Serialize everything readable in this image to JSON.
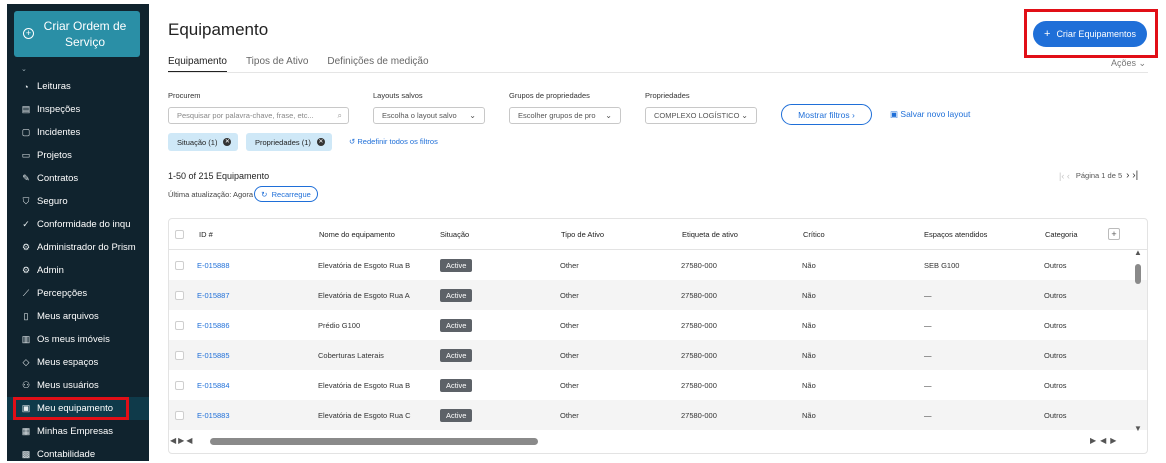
{
  "sidebar": {
    "create_label": "Criar Ordem de Serviço",
    "items": [
      {
        "label": "Leituras",
        "icon": "gauge-icon"
      },
      {
        "label": "Inspeções",
        "icon": "clipboard-icon"
      },
      {
        "label": "Incidentes",
        "icon": "alert-icon"
      },
      {
        "label": "Projetos",
        "icon": "folder-icon"
      },
      {
        "label": "Contratos",
        "icon": "contract-icon"
      },
      {
        "label": "Seguro",
        "icon": "shield-icon"
      },
      {
        "label": "Conformidade do inqu",
        "icon": "check-circle-icon"
      },
      {
        "label": "Administrador do Prism",
        "icon": "settings-icon"
      },
      {
        "label": "Admin",
        "icon": "settings-icon"
      },
      {
        "label": "Percepções",
        "icon": "trend-icon"
      },
      {
        "label": "Meus arquivos",
        "icon": "file-icon"
      },
      {
        "label": "Os meus imóveis",
        "icon": "building-icon"
      },
      {
        "label": "Meus espaços",
        "icon": "layers-icon"
      },
      {
        "label": "Meus usuários",
        "icon": "users-icon"
      },
      {
        "label": "Meu equipamento",
        "icon": "equipment-icon"
      },
      {
        "label": "Minhas Empresas",
        "icon": "company-icon"
      },
      {
        "label": "Contabilidade",
        "icon": "calculator-icon"
      }
    ]
  },
  "header": {
    "title": "Equipamento",
    "create_button": "Criar Equipamentos",
    "actions": "Ações"
  },
  "tabs": [
    "Equipamento",
    "Tipos de Ativo",
    "Definições de medição"
  ],
  "filters": {
    "search_label": "Procurem",
    "search_placeholder": "Pesquisar por palavra-chave, frase, etc...",
    "layouts_label": "Layouts salvos",
    "layouts_value": "Escolha o layout salvo",
    "groups_label": "Grupos de propriedades",
    "groups_value": "Escolher grupos de pro",
    "props_label": "Propriedades",
    "props_value": "COMPLEXO LOGÍSTICO",
    "show_filters": "Mostrar filtros",
    "save_layout": "Salvar novo layout",
    "chip_status": "Situação (1)",
    "chip_props": "Propriedades (1)",
    "reset": "Redefinir todos os filtros"
  },
  "summary": {
    "count": "1-50 of 215 Equipamento",
    "updated": "Última atualização: Agora",
    "reload": "Recarregue",
    "page": "Página 1 de 5"
  },
  "table": {
    "columns": [
      "ID #",
      "Nome do equipamento",
      "Situação",
      "Tipo de Ativo",
      "Etiqueta de ativo",
      "Crítico",
      "Espaços atendidos",
      "Categoria"
    ],
    "rows": [
      {
        "id": "E-015888",
        "name": "Elevatória de Esgoto Rua B",
        "status": "Active",
        "type": "Other",
        "tag": "27580-000",
        "critical": "Não",
        "spaces": "SEB G100",
        "category": "Outros"
      },
      {
        "id": "E-015887",
        "name": "Elevatória de Esgoto Rua A",
        "status": "Active",
        "type": "Other",
        "tag": "27580-000",
        "critical": "Não",
        "spaces": "—",
        "category": "Outros"
      },
      {
        "id": "E-015886",
        "name": "Prédio G100",
        "status": "Active",
        "type": "Other",
        "tag": "27580-000",
        "critical": "Não",
        "spaces": "—",
        "category": "Outros"
      },
      {
        "id": "E-015885",
        "name": "Coberturas Laterais",
        "status": "Active",
        "type": "Other",
        "tag": "27580-000",
        "critical": "Não",
        "spaces": "—",
        "category": "Outros"
      },
      {
        "id": "E-015884",
        "name": "Elevatória de Esgoto Rua B",
        "status": "Active",
        "type": "Other",
        "tag": "27580-000",
        "critical": "Não",
        "spaces": "—",
        "category": "Outros"
      },
      {
        "id": "E-015883",
        "name": "Elevatória de Esgoto Rua C",
        "status": "Active",
        "type": "Other",
        "tag": "27580-000",
        "critical": "Não",
        "spaces": "—",
        "category": "Outros"
      }
    ]
  }
}
